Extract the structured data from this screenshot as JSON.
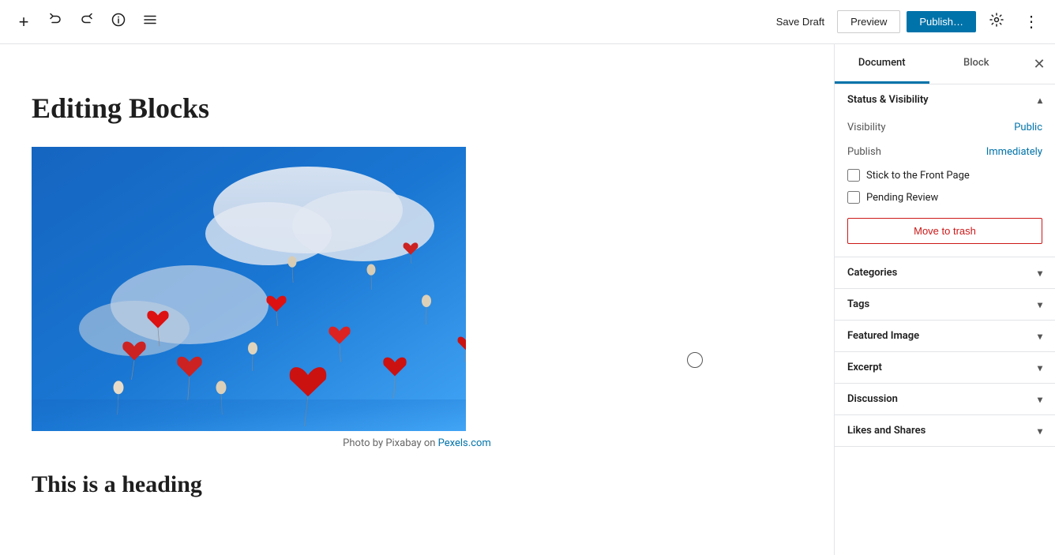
{
  "toolbar": {
    "save_draft_label": "Save Draft",
    "preview_label": "Preview",
    "publish_label": "Publish…",
    "add_block_title": "Add block",
    "undo_title": "Undo",
    "redo_title": "Redo",
    "info_title": "Document overview",
    "tools_title": "Tools"
  },
  "editor": {
    "post_title": "Editing Blocks",
    "image_caption_text": "Photo by Pixabay on ",
    "image_caption_link": "Pexels.com",
    "post_heading": "This is a heading"
  },
  "sidebar": {
    "tab_document": "Document",
    "tab_block": "Block",
    "close_title": "Close settings",
    "status_visibility": {
      "section_title": "Status & Visibility",
      "visibility_label": "Visibility",
      "visibility_value": "Public",
      "publish_label": "Publish",
      "publish_value": "Immediately",
      "stick_front_page_label": "Stick to the Front Page",
      "pending_review_label": "Pending Review",
      "move_to_trash_label": "Move to trash"
    },
    "categories": {
      "label": "Categories"
    },
    "tags": {
      "label": "Tags"
    },
    "featured_image": {
      "label": "Featured Image"
    },
    "excerpt": {
      "label": "Excerpt"
    },
    "discussion": {
      "label": "Discussion"
    },
    "likes_shares": {
      "label": "Likes and Shares"
    }
  },
  "icons": {
    "add": "+",
    "undo": "↺",
    "redo": "↻",
    "info": "ℹ",
    "tools": "≡",
    "close": "✕",
    "chevron_down": "▾",
    "chevron_up": "▴",
    "settings_gear": "⚙",
    "more_vertical": "⋮"
  }
}
